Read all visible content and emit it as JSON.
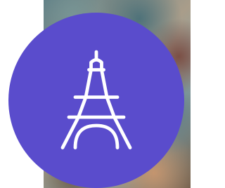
{
  "badge": {
    "icon": "eiffel-tower-icon",
    "background_color": "#5a4ccc",
    "icon_color": "#ffffff"
  },
  "background": {
    "type": "photo"
  }
}
